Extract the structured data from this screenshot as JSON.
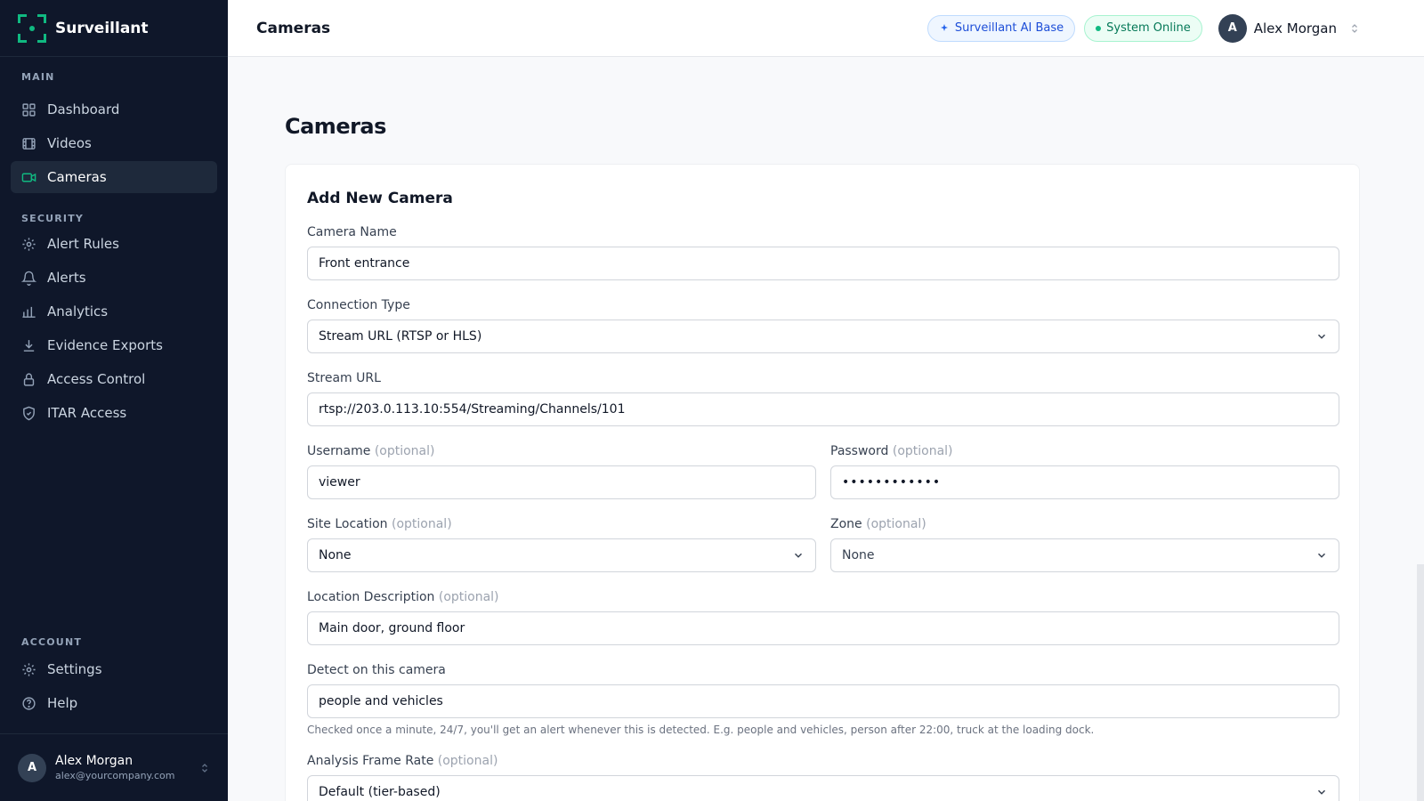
{
  "brand": {
    "name": "Surveillant"
  },
  "sidebar": {
    "sections": [
      {
        "title": "MAIN",
        "items": [
          {
            "label": "Dashboard",
            "icon": "grid-icon"
          },
          {
            "label": "Videos",
            "icon": "film-icon"
          },
          {
            "label": "Cameras",
            "icon": "camera-icon",
            "active": true
          }
        ]
      },
      {
        "title": "SECURITY",
        "items": [
          {
            "label": "Alert Rules",
            "icon": "gear-icon"
          },
          {
            "label": "Alerts",
            "icon": "bell-icon"
          },
          {
            "label": "Analytics",
            "icon": "bar-chart-icon"
          },
          {
            "label": "Evidence Exports",
            "icon": "download-icon"
          },
          {
            "label": "Access Control",
            "icon": "lock-icon"
          },
          {
            "label": "ITAR Access",
            "icon": "shield-check-icon"
          }
        ]
      },
      {
        "title": "ACCOUNT",
        "items": [
          {
            "label": "Settings",
            "icon": "gear-icon"
          },
          {
            "label": "Help",
            "icon": "help-circle-icon"
          }
        ]
      }
    ],
    "user": {
      "initial": "A",
      "name": "Alex Morgan",
      "email": "alex@yourcompany.com"
    }
  },
  "topbar": {
    "title": "Cameras",
    "ai_badge": "Surveillant AI Base",
    "status_badge": "System Online",
    "user": {
      "initial": "A",
      "name": "Alex Morgan"
    }
  },
  "page": {
    "title": "Cameras"
  },
  "form": {
    "title": "Add New Camera",
    "camera_name": {
      "label": "Camera Name",
      "value": "Front entrance"
    },
    "connection_type": {
      "label": "Connection Type",
      "value": "Stream URL (RTSP or HLS)"
    },
    "stream_url": {
      "label": "Stream URL",
      "value": "rtsp://203.0.113.10:554/Streaming/Channels/101"
    },
    "username": {
      "label": "Username",
      "optional": "(optional)",
      "value": "viewer"
    },
    "password": {
      "label": "Password",
      "optional": "(optional)",
      "value": "••••••••••••"
    },
    "site_location": {
      "label": "Site Location",
      "optional": "(optional)",
      "value": "None"
    },
    "zone": {
      "label": "Zone",
      "optional": "(optional)",
      "value": "None"
    },
    "location_description": {
      "label": "Location Description",
      "optional": "(optional)",
      "value": "Main door, ground floor"
    },
    "detect": {
      "label": "Detect on this camera",
      "value": "people and vehicles",
      "help": "Checked once a minute, 24/7, you'll get an alert whenever this is detected. E.g. people and vehicles, person after 22:00, truck at the loading dock."
    },
    "frame_rate": {
      "label": "Analysis Frame Rate",
      "optional": "(optional)",
      "value": "Default (tier-based)"
    }
  },
  "colors": {
    "sidebar_bg": "#0f172a",
    "accent": "#10b981",
    "active_bg": "#1e293b"
  }
}
